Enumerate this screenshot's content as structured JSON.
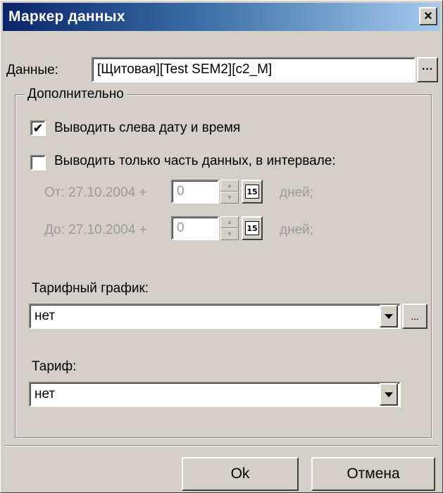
{
  "window": {
    "title": "Маркер данных",
    "close_glyph": "×"
  },
  "data_row": {
    "label": "Данные:",
    "value": "[Щитовая][Test SEM2][c2_M]",
    "browse_label": "···"
  },
  "group": {
    "title": "Дополнительно",
    "show_date_time": {
      "label": "Выводить слева дату и время",
      "checked": true,
      "check_glyph": "✔"
    },
    "partial_data": {
      "label": "Выводить только часть данных, в интервале:",
      "checked": false
    },
    "from": {
      "label": "От: 27.10.2004 +",
      "value": "0",
      "unit": "дней;",
      "cal_label": "15"
    },
    "to": {
      "label": "До: 27.10.2004 +",
      "value": "0",
      "unit": "дней;",
      "cal_label": "15"
    },
    "tariff_schedule": {
      "label": "Тарифный график:",
      "value": "нет",
      "more_label": "..."
    },
    "tariff": {
      "label": "Тариф:",
      "value": "нет"
    }
  },
  "buttons": {
    "ok": "Ok",
    "cancel": "Отмена"
  },
  "colors": {
    "face": "#d4d0c8",
    "title_start": "#0a246a",
    "title_end": "#a6caf0",
    "disabled_text": "#9c9a94"
  }
}
